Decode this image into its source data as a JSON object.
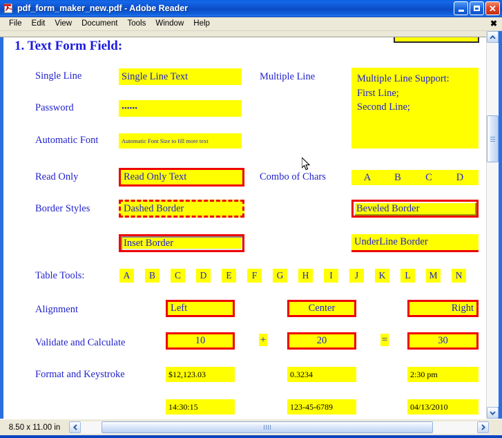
{
  "window": {
    "title": "pdf_form_maker_new.pdf - Adobe Reader",
    "app_icon": "pdf-document-icon",
    "minimize_label": "",
    "maximize_label": "",
    "close_label": "✕"
  },
  "menu": {
    "items": [
      "File",
      "Edit",
      "View",
      "Document",
      "Tools",
      "Window",
      "Help"
    ],
    "close_toolbar_label": "✖"
  },
  "document": {
    "heading": "1. Text Form Field:",
    "rows": {
      "single_line": {
        "label": "Single Line",
        "value": "Single Line Text"
      },
      "multiple_line": {
        "label": "Multiple Line",
        "value": "Multiple Line Support:\nFirst Line;\nSecond Line;"
      },
      "password": {
        "label": "Password",
        "value": "••••••"
      },
      "automatic_font": {
        "label": "Automatic Font",
        "value": "Automatic Font Size to fill more text"
      },
      "read_only": {
        "label": "Read Only",
        "value": "Read Only Text"
      },
      "combo_of_chars": {
        "label": "Combo of Chars",
        "options": [
          "A",
          "B",
          "C",
          "D"
        ]
      },
      "border_styles": {
        "label": "Border Styles",
        "dashed": "Dashed Border",
        "beveled": "Beveled Border",
        "inset": "Inset Border",
        "underline": "UnderLine Border"
      },
      "table_tools": {
        "label": "Table Tools:",
        "cells": [
          "A",
          "B",
          "C",
          "D",
          "E",
          "F",
          "G",
          "H",
          "I",
          "J",
          "K",
          "L",
          "M",
          "N"
        ]
      },
      "alignment": {
        "label": "Alignment",
        "left": "Left",
        "center": "Center",
        "right": "Right"
      },
      "validate_and_calculate": {
        "label": "Validate and Calculate",
        "operand_a": "10",
        "operator_plus": "+",
        "operand_b": "20",
        "operator_equals": "=",
        "result": "30"
      },
      "format_and_keystroke": {
        "label": "Format and Keystroke",
        "currency": "$12,123.03",
        "percent": "0.3234",
        "time_12h": "2:30 pm",
        "time_24h": "14:30:15",
        "ssn": "123-45-6789",
        "date": "04/13/2010"
      }
    }
  },
  "scrollbars": {
    "vertical_up_label": "▲",
    "vertical_down_label": "▼",
    "horizontal_left_label": "◀",
    "horizontal_right_label": "▶"
  },
  "status": {
    "page_size": "8.50 x 11.00 in"
  },
  "colors": {
    "field_fill": "#ffff00",
    "field_border": "#ee0000",
    "label_text": "#2222cc",
    "heading_text": "#1a1ae0",
    "titlebar": "#0d54d0"
  }
}
